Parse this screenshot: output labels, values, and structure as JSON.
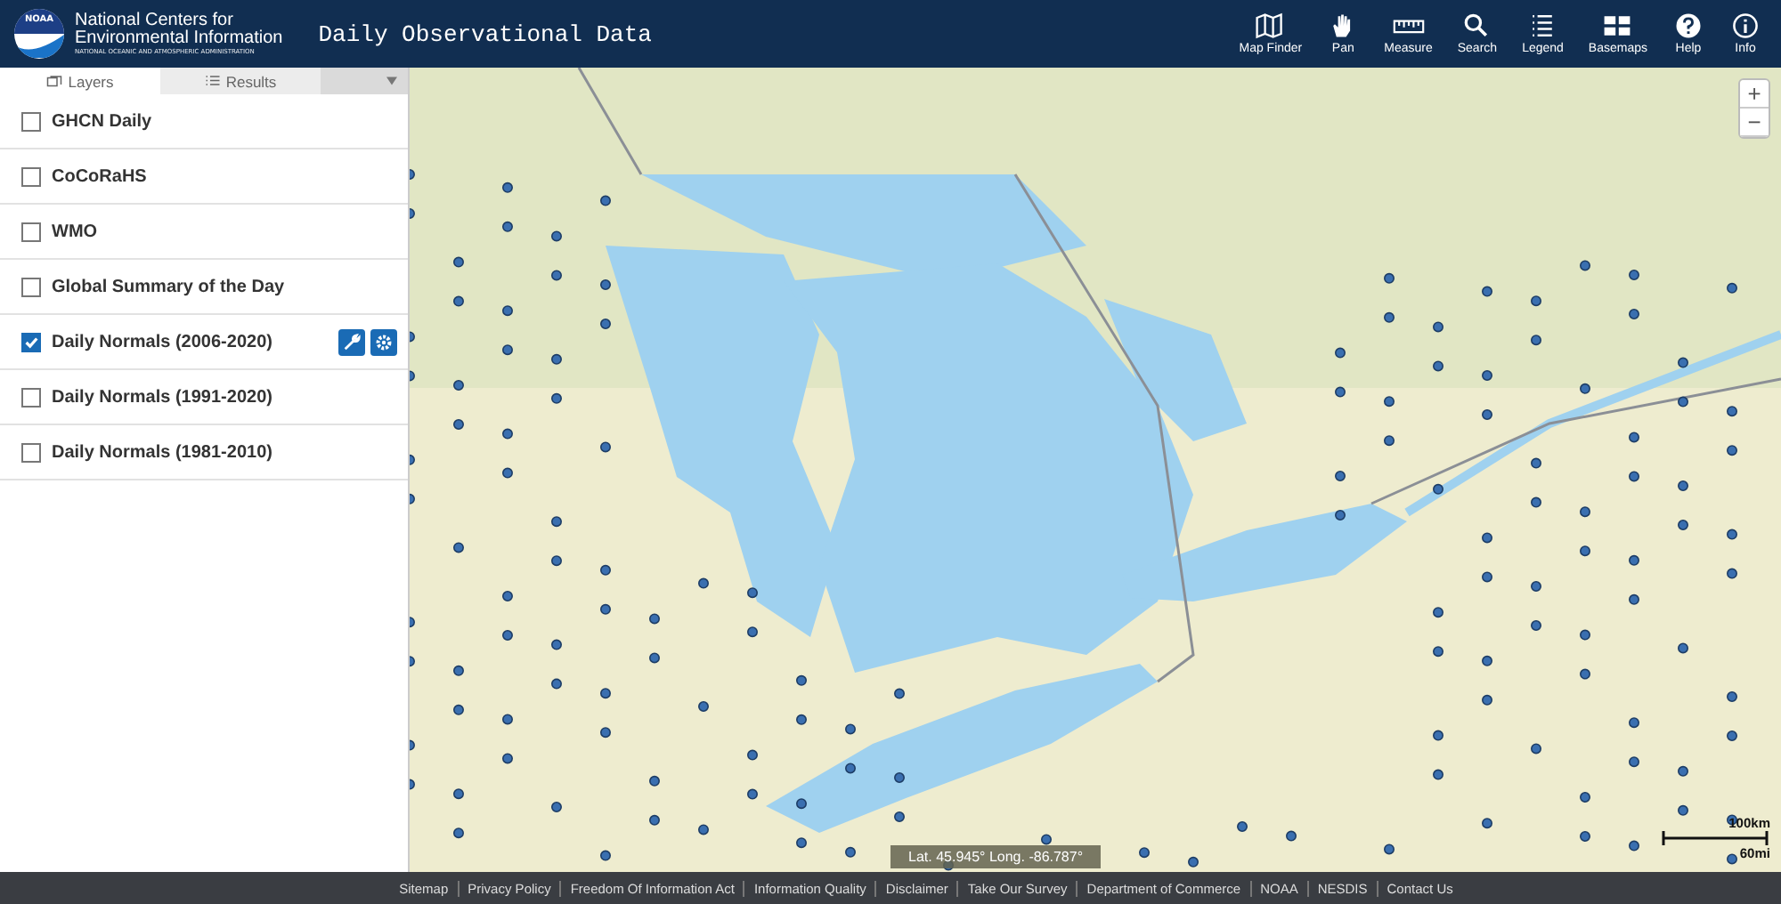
{
  "header": {
    "logo_text": "NOAA",
    "org_line1": "National Centers for",
    "org_line2": "Environmental Information",
    "org_line3": "NATIONAL OCEANIC AND ATMOSPHERIC ADMINISTRATION",
    "title": "Daily Observational Data"
  },
  "toolbar": [
    {
      "label": "Map Finder",
      "kind": "mapfinder"
    },
    {
      "label": "Pan",
      "kind": "pan"
    },
    {
      "label": "Measure",
      "kind": "measure"
    },
    {
      "label": "Search",
      "kind": "search"
    },
    {
      "label": "Legend",
      "kind": "legend"
    },
    {
      "label": "Basemaps",
      "kind": "basemaps"
    },
    {
      "label": "Help",
      "kind": "help"
    },
    {
      "label": "Info",
      "kind": "info"
    }
  ],
  "tabs": [
    {
      "label": "Layers",
      "selected": true
    },
    {
      "label": "Results",
      "selected": false
    }
  ],
  "layers": [
    {
      "label": "GHCN Daily",
      "checked": false,
      "tools_shown": false
    },
    {
      "label": "CoCoRaHS",
      "checked": false,
      "tools_shown": false
    },
    {
      "label": "WMO",
      "checked": false,
      "tools_shown": false
    },
    {
      "label": "Global Summary of the Day",
      "checked": false,
      "tools_shown": false
    },
    {
      "label": "Daily Normals (2006-2020)",
      "checked": true,
      "tools_shown": true
    },
    {
      "label": "Daily Normals (1991-2020)",
      "checked": false,
      "tools_shown": false
    },
    {
      "label": "Daily Normals (1981-2010)",
      "checked": false,
      "tools_shown": false
    }
  ],
  "map": {
    "zoom_in": "+",
    "zoom_out": "−",
    "coordinates": "Lat. 45.945° Long. -86.787°",
    "scale_metric": "100km",
    "scale_imperial": "60mi"
  },
  "footer": [
    "Sitemap",
    "Privacy Policy",
    "Freedom Of Information Act",
    "Information Quality",
    "Disclaimer",
    "Take Our Survey",
    "Department of Commerce",
    "NOAA",
    "NESDIS",
    "Contact Us"
  ]
}
